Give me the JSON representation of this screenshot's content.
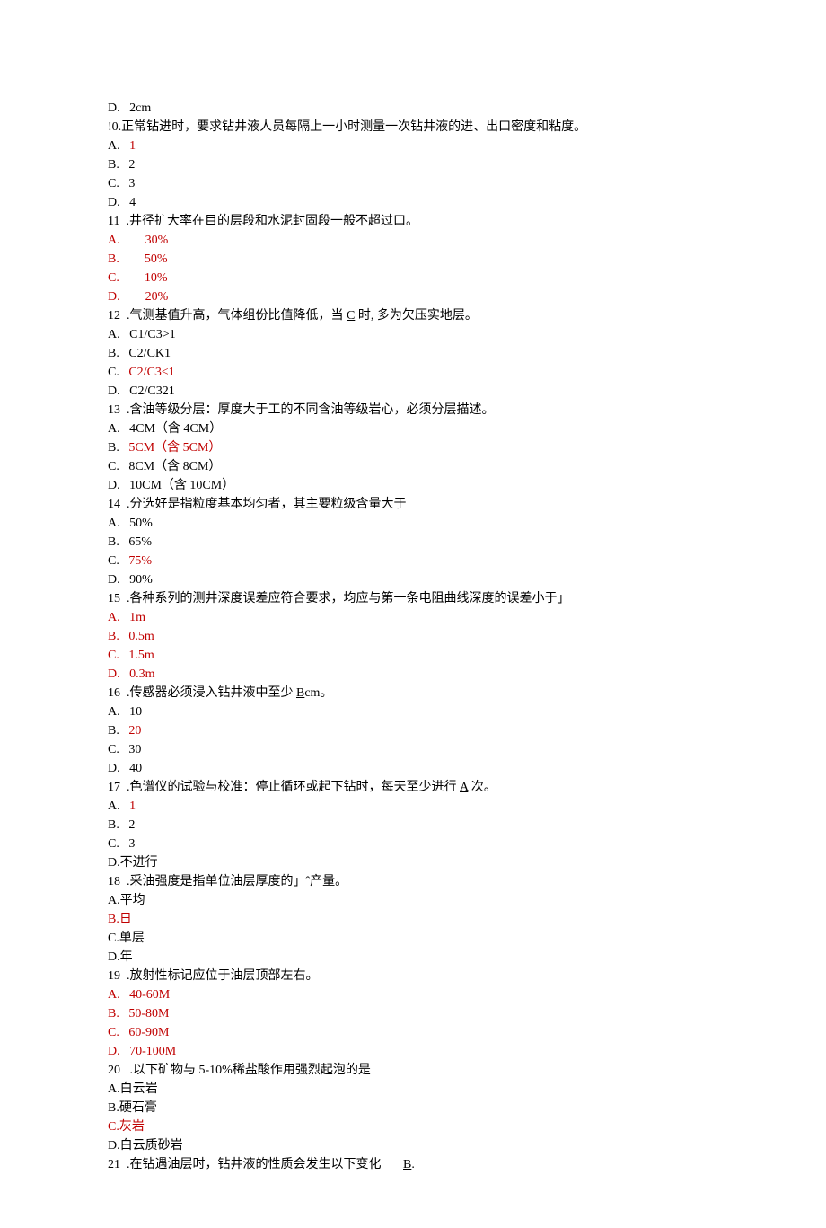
{
  "q9d": {
    "label": "D.",
    "text": "2cm"
  },
  "q10": {
    "stem_prefix": "!0.正常钻进时，要求钻井液人员每隔上一小时测量一次钻井液的进、出口密度和粘度。",
    "A": "1",
    "B": "2",
    "C": "3",
    "D": "4",
    "answer": "A"
  },
  "q11": {
    "num": "11",
    "stem": ".井径扩大率在目的层段和水泥封固段一般不超过口。",
    "A": "30%",
    "B": "50%",
    "C": "10%",
    "D": "20%",
    "answer": "D"
  },
  "q12": {
    "num": "12",
    "stem_before": ".气测基值升高，气体组份比值降低，当 ",
    "stem_u": "C",
    "stem_after": " 时, 多为欠压实地层。",
    "A": "C1/C3>1",
    "B": "C2/CK1",
    "C": "C2/C3≤1",
    "D": "C2/C321",
    "answer": "C"
  },
  "q13": {
    "num": "13",
    "stem": ".含油等级分层：厚度大于工的不同含油等级岩心，必须分层描述。",
    "A": "4CM（含 4CM）",
    "B": "5CM（含 5CM）",
    "C": "8CM（含 8CM）",
    "D": "10CM（含 10CM）",
    "answer": "B"
  },
  "q14": {
    "num": "14",
    "stem": ".分选好是指粒度基本均匀者，其主要粒级含量大于",
    "A": "50%",
    "B": "65%",
    "C": "75%",
    "D": "90%",
    "answer": "C"
  },
  "q15": {
    "num": "15",
    "stem": ".各种系列的测井深度误差应符合要求，均应与第一条电阻曲线深度的误差小于」",
    "A": "1m",
    "B": "0.5m",
    "C": "1.5m",
    "D": "0.3m",
    "answer": "D"
  },
  "q16": {
    "num": "16",
    "stem_before": ".传感器必须浸入钻井液中至少 ",
    "stem_u": "B",
    "stem_after": "cm。",
    "A": "10",
    "B": "20",
    "C": "30",
    "D": "40",
    "answer": "B"
  },
  "q17": {
    "num": "17",
    "stem_before": ".色谱仪的试验与校准：停止循环或起下钻时，每天至少进行 ",
    "stem_u": "A",
    "stem_after": " 次。",
    "A": "1",
    "B": "2",
    "C": "3",
    "D": "不进行",
    "answer": "A"
  },
  "q18": {
    "num": "18",
    "stem": ".采油强度是指单位油层厚度的」ˆ产量。",
    "A": "平均",
    "B": "日",
    "C": "单层",
    "D": "年",
    "answer": "B"
  },
  "q19": {
    "num": "19",
    "stem": ".放射性标记应位于油层顶部左右。",
    "A": "40-60M",
    "B": "50-80M",
    "C": "60-90M",
    "D": "70-100M",
    "answer": "D"
  },
  "q20": {
    "num": "20",
    "stem": ".以下矿物与 5-10%稀盐酸作用强烈起泡的是",
    "A": "白云岩",
    "B": "硬石膏",
    "C": "灰岩",
    "D": "白云质砂岩",
    "answer": "C"
  },
  "q21": {
    "num": "21",
    "stem_before": ".在钻遇油层时，钻井液的性质会发生以下变化       ",
    "stem_u": "B",
    "stem_after": "."
  }
}
